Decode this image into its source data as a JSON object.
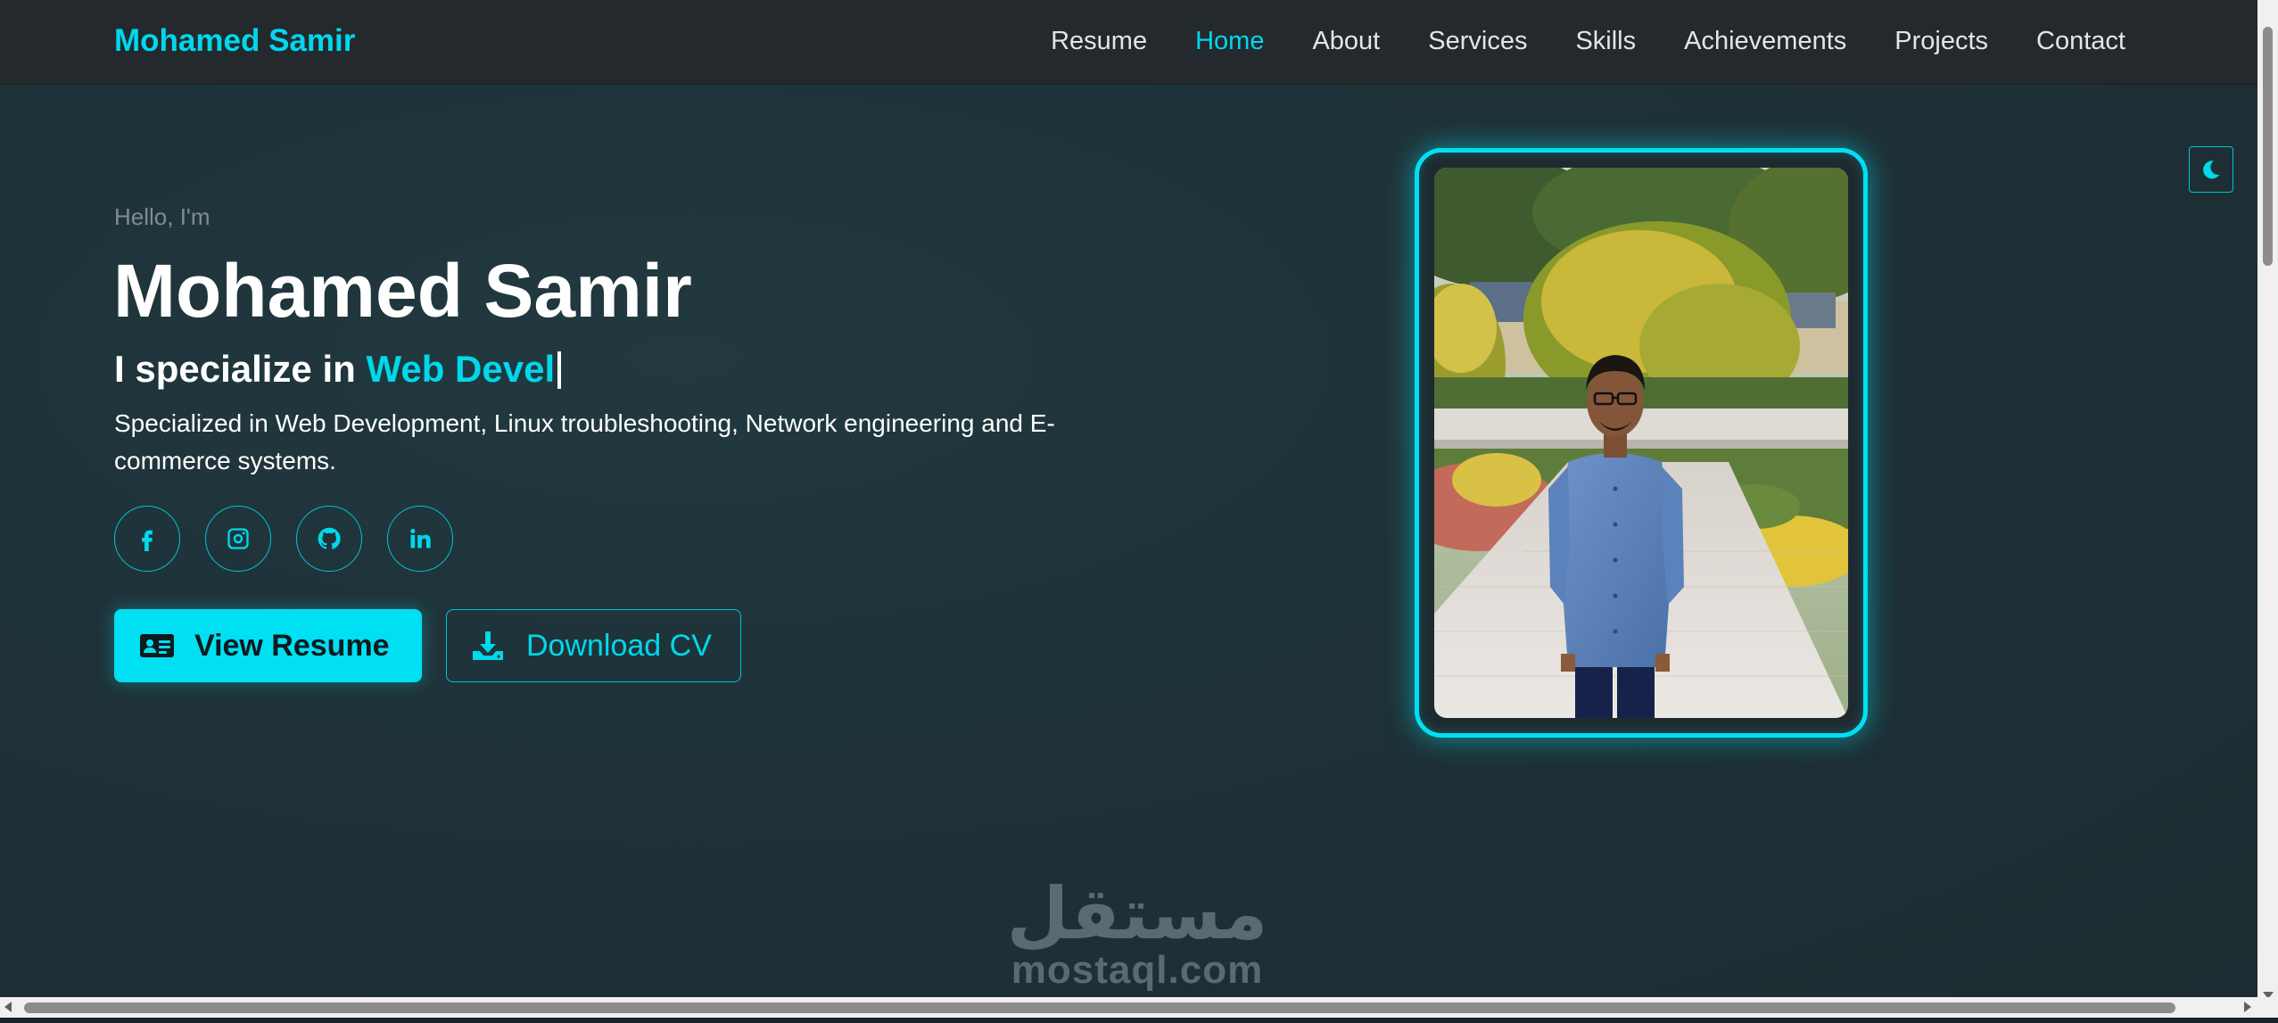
{
  "brand": "Mohamed Samir",
  "nav": {
    "items": [
      "Resume",
      "Home",
      "About",
      "Services",
      "Skills",
      "Achievements",
      "Projects",
      "Contact"
    ],
    "active": "Home"
  },
  "hero": {
    "greeting": "Hello, I'm",
    "name": "Mohamed Samir",
    "specialize_prefix": "I specialize in ",
    "specialize_typed": "Web Devel",
    "description": "Specialized in Web Development, Linux troubleshooting, Network engineering and E-commerce systems.",
    "view_resume_label": "View Resume",
    "download_cv_label": "Download CV"
  },
  "socials": [
    {
      "icon": "facebook-icon"
    },
    {
      "icon": "instagram-icon"
    },
    {
      "icon": "github-icon"
    },
    {
      "icon": "linkedin-icon"
    }
  ],
  "photo": {
    "icon": "profile-photo"
  },
  "theme_toggle": {
    "icon": "moon-icon"
  },
  "watermark": {
    "arabic": "مستقل",
    "latin": "mostaql.com"
  },
  "colors": {
    "accent": "#00d8ec",
    "background": "#1e3238",
    "navbar": "#23292d",
    "text": "#ffffff",
    "muted": "#7f8d92"
  }
}
